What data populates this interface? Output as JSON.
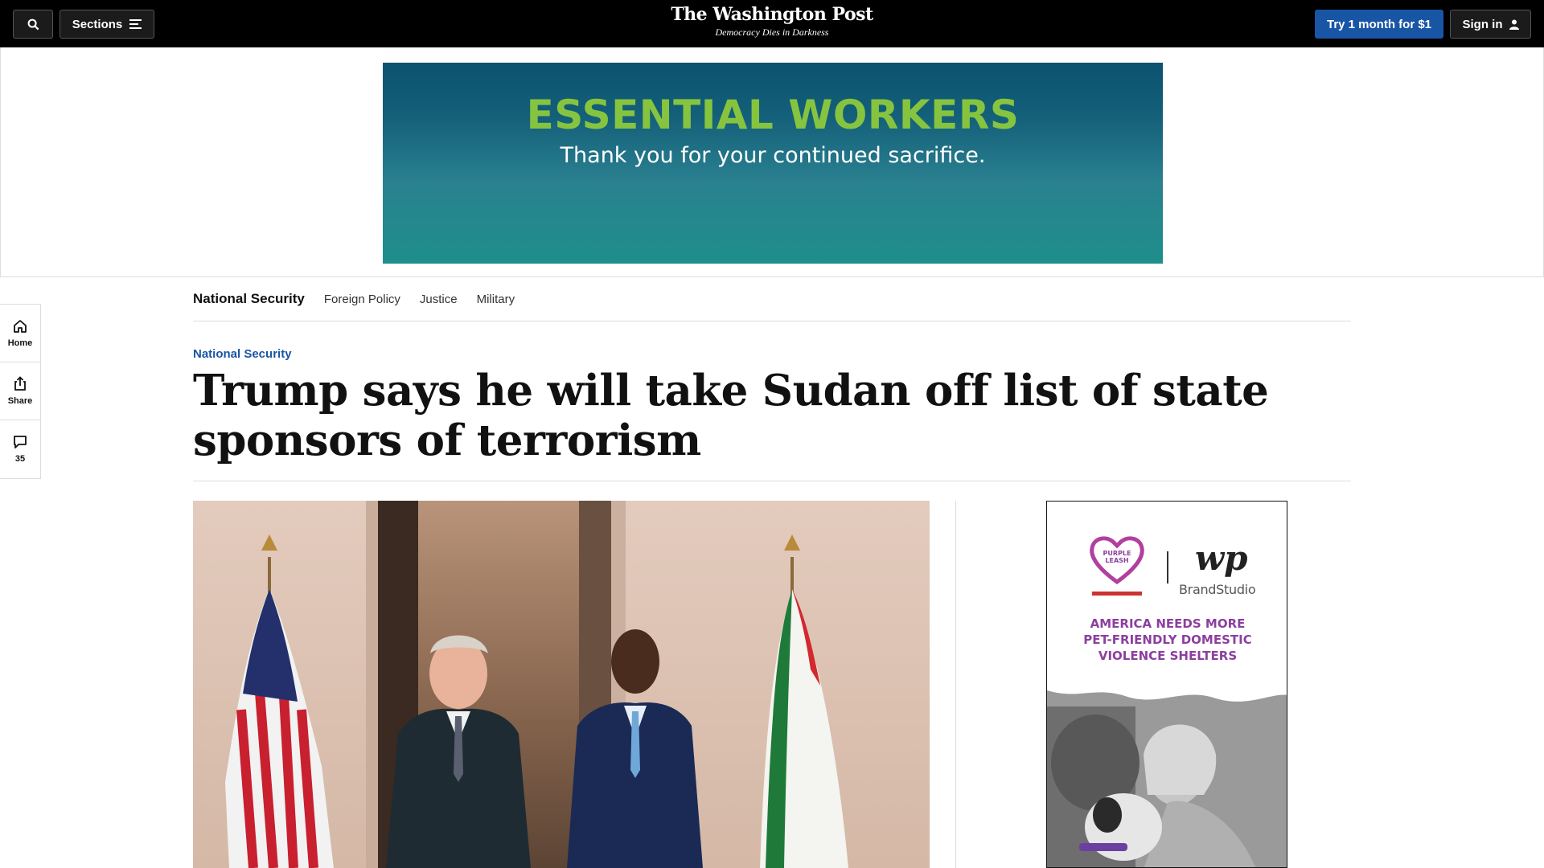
{
  "header": {
    "sections_label": "Sections",
    "logo_name": "The Washington Post",
    "logo_tagline": "Democracy Dies in Darkness",
    "try_label": "Try 1 month for $1",
    "signin_label": "Sign in"
  },
  "top_ad": {
    "headline": "ESSENTIAL WORKERS",
    "subline": "Thank you for your continued sacrifice."
  },
  "rail": {
    "home": "Home",
    "share": "Share",
    "comments": "35"
  },
  "subnav": {
    "current": "National Security",
    "links": [
      "Foreign Policy",
      "Justice",
      "Military"
    ]
  },
  "article": {
    "kicker": "National Security",
    "headline": "Trump says he will take Sudan off list of state sponsors of terrorism"
  },
  "side_ad": {
    "wp_mark": "wp",
    "brand": "BrandStudio",
    "line1": "AMERICA NEEDS MORE",
    "line2": "PET-FRIENDLY DOMESTIC",
    "line3": "VIOLENCE SHELTERS"
  },
  "colors": {
    "accent_blue": "#1955a5",
    "ad_green": "#86c440",
    "ad_purple": "#8c3f9f"
  }
}
